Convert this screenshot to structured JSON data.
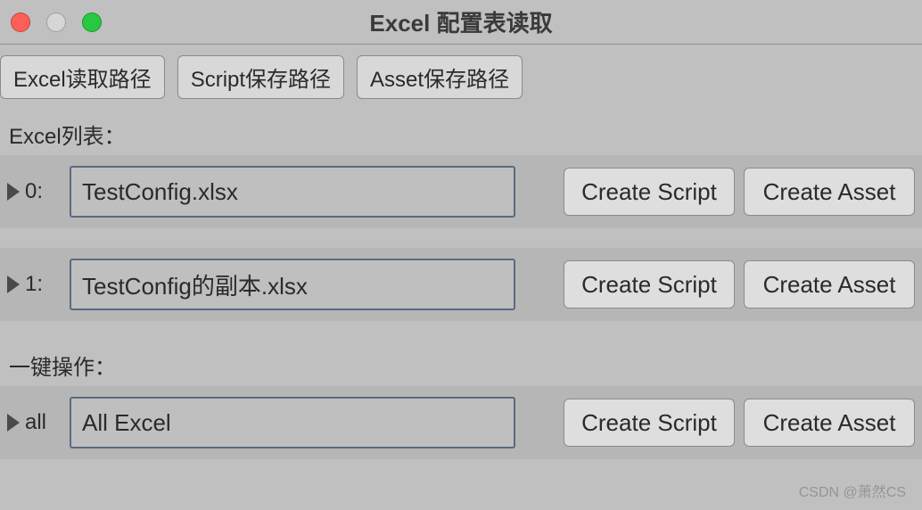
{
  "window": {
    "title": "Excel 配置表读取"
  },
  "toolbar": {
    "excel_path_btn": "Excel读取路径",
    "script_path_btn": "Script保存路径",
    "asset_path_btn": "Asset保存路径"
  },
  "sections": {
    "list_label": "Excel列表：",
    "batch_label": "一键操作："
  },
  "rows": [
    {
      "index_label": "0:",
      "filename": "TestConfig.xlsx",
      "create_script": "Create Script",
      "create_asset": "Create Asset"
    },
    {
      "index_label": "1:",
      "filename": "TestConfig的副本.xlsx",
      "create_script": "Create Script",
      "create_asset": "Create Asset"
    }
  ],
  "batch": {
    "index_label": "all",
    "filename": "All Excel",
    "create_script": "Create Script",
    "create_asset": "Create Asset"
  },
  "watermark": "CSDN @萧然CS"
}
